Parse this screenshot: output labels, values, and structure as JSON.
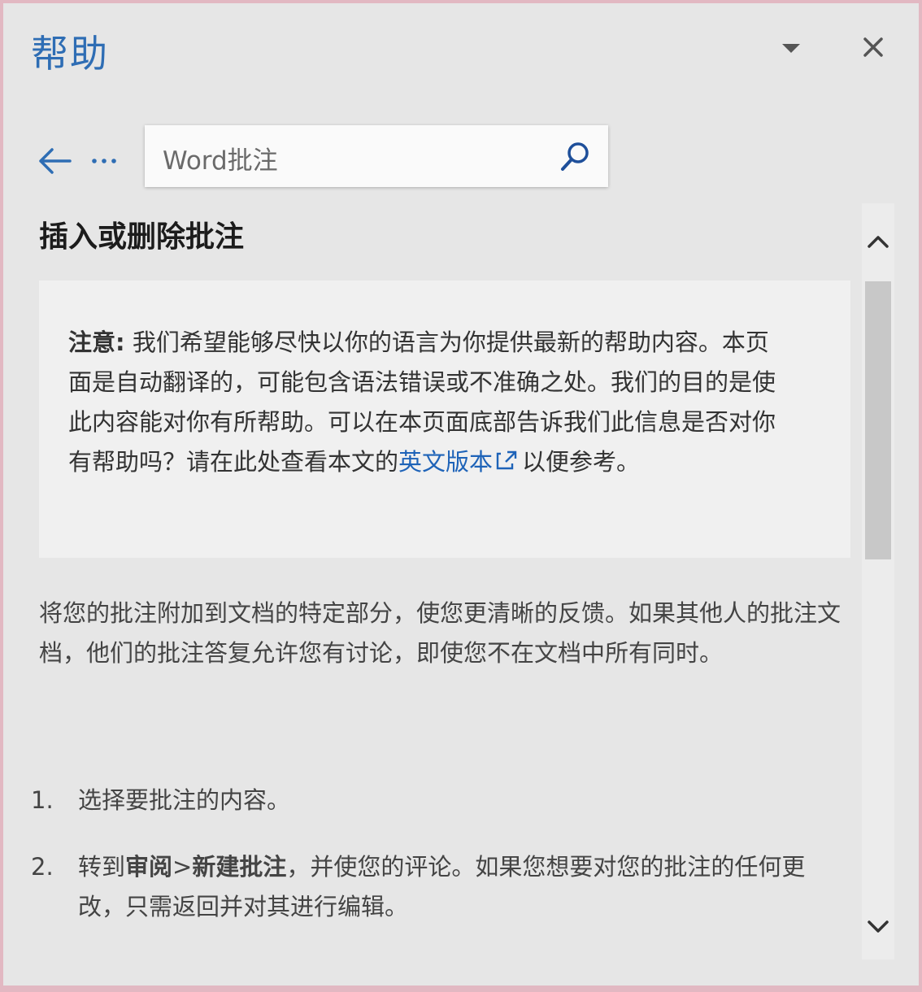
{
  "pane": {
    "title": "帮助",
    "dropdown_icon": "chevron-down-icon",
    "close_icon": "close-icon"
  },
  "nav": {
    "back_icon": "back-arrow-icon",
    "more_icon": "more-icon"
  },
  "search": {
    "value": "Word批注",
    "icon": "search-icon"
  },
  "article": {
    "title": "插入或删除批注",
    "note": {
      "label": "注意:",
      "text_before_link": " 我们希望能够尽快以你的语言为你提供最新的帮助内容。本页面是自动翻译的，可能包含语法错误或不准确之处。我们的目的是使此内容能对你有所帮助。可以在本页面底部告诉我们此信息是否对你有帮助吗？请在此处查看本文的",
      "link_text": "英文版本",
      "text_after_link": "以便参考。"
    },
    "intro": "将您的批注附加到文档的特定部分，使您更清晰的反馈。如果其他人的批注文档，他们的批注答复允许您有讨论，即使您不在文档中所有同时。",
    "steps": [
      {
        "number": "1.",
        "text": "选择要批注的内容。"
      },
      {
        "number": "2.",
        "prefix": "转到",
        "bold1": "审阅",
        "sep": ">",
        "bold2": "新建批注",
        "suffix": "，并使您的评论。如果您想要对您的批注的任何更改，只需返回并对其进行编辑。"
      }
    ]
  },
  "colors": {
    "accent": "#2e6db4",
    "link": "#1e63b8",
    "pane_bg": "#e6e6e6",
    "note_bg": "#f0f0f0"
  }
}
